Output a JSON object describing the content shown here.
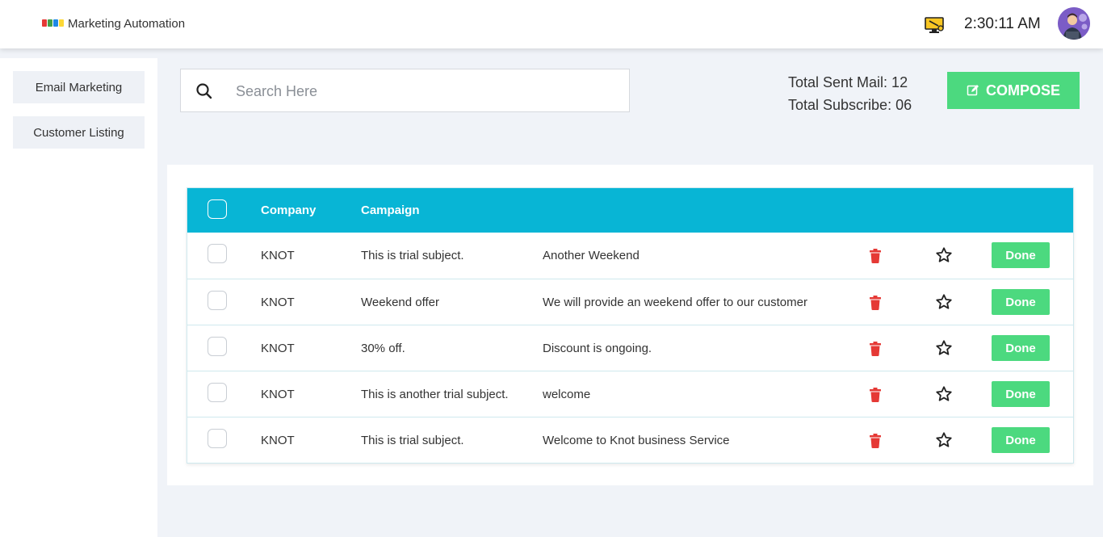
{
  "header": {
    "app_title": "Marketing Automation",
    "clock": "2:30:11 AM",
    "logo_colors": [
      "#e53935",
      "#43a047",
      "#1e88e5",
      "#fdd835"
    ]
  },
  "sidebar": {
    "items": [
      {
        "label": "Email Marketing"
      },
      {
        "label": "Customer Listing"
      }
    ]
  },
  "search": {
    "placeholder": "Search Here",
    "value": ""
  },
  "stats": {
    "sent_mail": "Total Sent Mail: 12",
    "subscribe": "Total Subscribe: 06"
  },
  "compose": {
    "label": "COMPOSE"
  },
  "table": {
    "headers": {
      "company": "Company",
      "campaign": "Campaign"
    },
    "rows": [
      {
        "company": "KNOT",
        "subject": "This is trial subject.",
        "campaign": "Another Weekend",
        "action": "Done"
      },
      {
        "company": "KNOT",
        "subject": "Weekend offer",
        "campaign": "We will provide an weekend offer to our customer",
        "action": "Done"
      },
      {
        "company": "KNOT",
        "subject": "30% off.",
        "campaign": "Discount is ongoing.",
        "action": "Done"
      },
      {
        "company": "KNOT",
        "subject": "This is another trial subject.",
        "campaign": "welcome",
        "action": "Done"
      },
      {
        "company": "KNOT",
        "subject": "This is trial subject.",
        "campaign": "Welcome to Knot business Service",
        "action": "Done"
      }
    ]
  },
  "colors": {
    "accent": "#08b5d5",
    "success": "#4cd97f",
    "danger": "#e53935"
  }
}
